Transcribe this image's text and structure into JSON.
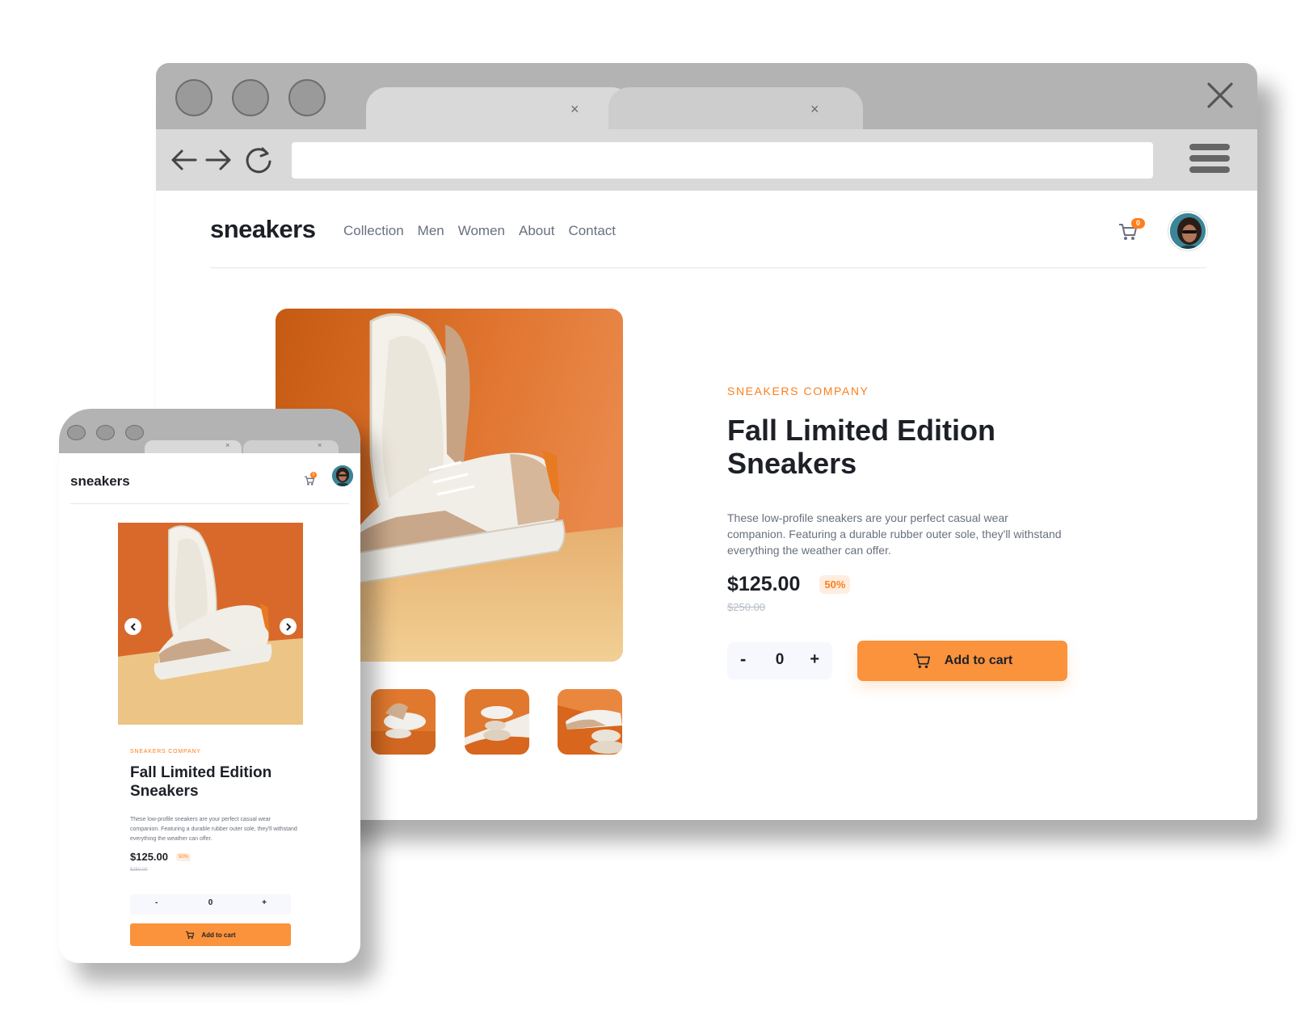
{
  "browser": {
    "tabs": [
      {
        "close": "×"
      },
      {
        "close": "×"
      }
    ],
    "window_close_icon": "close-icon",
    "url": ""
  },
  "site": {
    "logo": "sneakers",
    "nav": [
      "Collection",
      "Men",
      "Women",
      "About",
      "Contact"
    ],
    "cart_count": "0",
    "accent_color": "#ff7e1b"
  },
  "product": {
    "company": "SNEAKERS COMPANY",
    "title": "Fall Limited Edition Sneakers",
    "description": "These low-profile sneakers are your perfect casual wear companion. Featuring a durable rubber outer sole, they'll withstand everything the weather can offer.",
    "price": "$125.00",
    "discount": "50%",
    "old_price": "$250.00",
    "quantity": "0",
    "minus": "-",
    "plus": "+",
    "add_to_cart": "Add to cart"
  },
  "mobile": {
    "logo": "sneakers",
    "cart_count": "0",
    "company": "SNEAKERS COMPANY",
    "title": "Fall Limited Edition Sneakers",
    "description": "These low-profile sneakers are your perfect casual wear companion. Featuring a durable rubber outer sole, they'll withstand everything the weather can offer.",
    "price": "$125.00",
    "discount": "50%",
    "old_price": "$250.00",
    "quantity": "0",
    "minus": "-",
    "plus": "+",
    "add_to_cart": "Add to cart",
    "tabs": [
      {
        "close": "×"
      },
      {
        "close": "×"
      }
    ]
  }
}
